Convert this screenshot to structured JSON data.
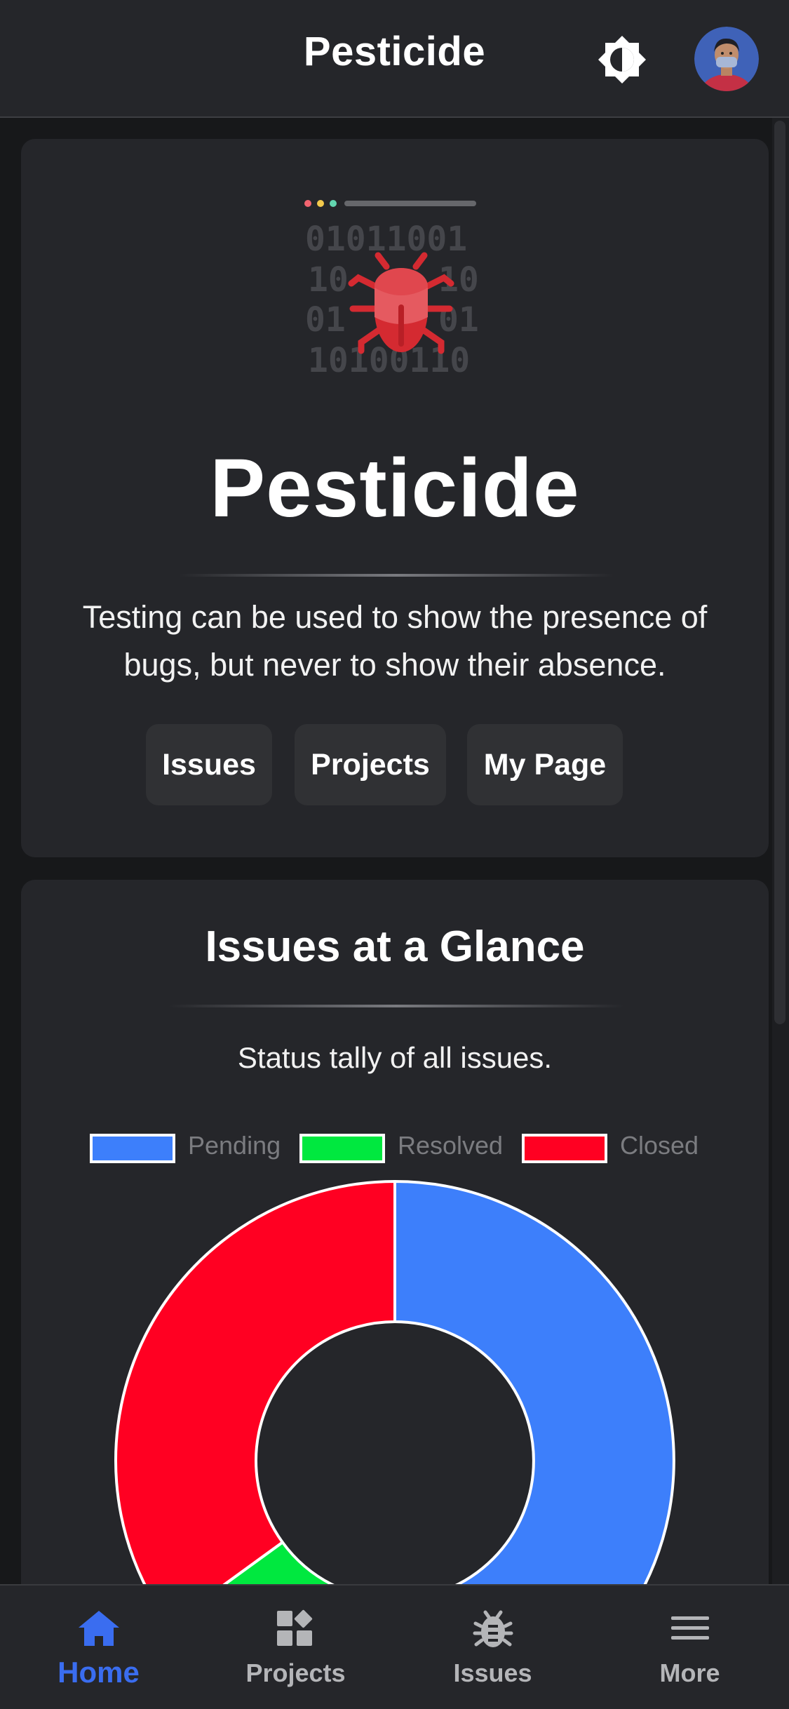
{
  "app": {
    "title": "Pesticide"
  },
  "header": {
    "theme_toggle_icon": "brightness-icon",
    "avatar_icon": "user-avatar"
  },
  "hero": {
    "title": "Pesticide",
    "quote": "Testing can be used to show the presence of bugs, but never to show their absence.",
    "illustration": {
      "icon": "bug-binary-icon",
      "binary_rows": [
        "01011001",
        "10",
        "10",
        "01",
        "01",
        "10100110"
      ]
    },
    "buttons": {
      "issues": "Issues",
      "projects": "Projects",
      "my_page": "My Page"
    }
  },
  "glance": {
    "title": "Issues at a Glance",
    "subtitle": "Status tally of all issues."
  },
  "chart_data": {
    "type": "pie",
    "style": "doughnut",
    "categories": [
      "Pending",
      "Resolved",
      "Closed"
    ],
    "values": [
      50,
      15,
      35
    ],
    "colors": [
      "#3d7ffb",
      "#00e83f",
      "#ff0022"
    ],
    "legend_position": "top",
    "title": ""
  },
  "bottom_nav": {
    "items": [
      {
        "label": "Home",
        "icon": "home-icon",
        "active": true
      },
      {
        "label": "Projects",
        "icon": "projects-grid-icon",
        "active": false
      },
      {
        "label": "Issues",
        "icon": "bug-icon",
        "active": false
      },
      {
        "label": "More",
        "icon": "menu-icon",
        "active": false
      }
    ]
  },
  "colors": {
    "accent": "#3a6df0",
    "background": "#17181a",
    "surface": "#25262a",
    "button": "#303134"
  }
}
